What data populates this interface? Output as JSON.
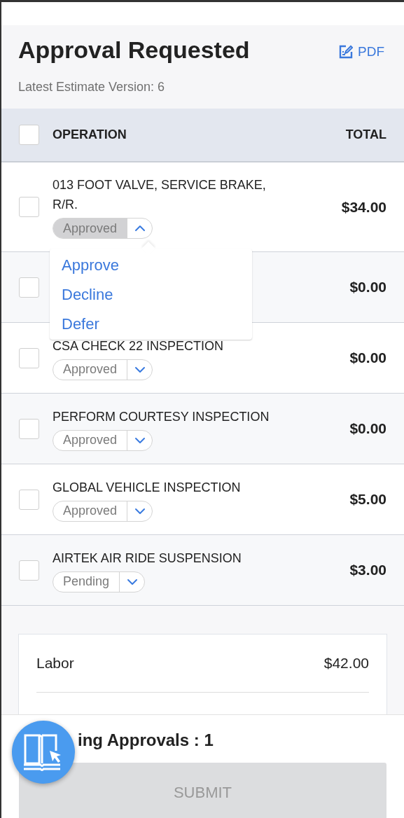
{
  "header": {
    "title": "Approval Requested",
    "pdf_label": "PDF",
    "subtitle": "Latest Estimate Version: 6"
  },
  "table": {
    "select_all_checked": false,
    "columns": [
      "OPERATION",
      "TOTAL"
    ],
    "rows": [
      {
        "operation": "013 FOOT VALVE, SERVICE BRAKE, R/R.",
        "total": "$34.00",
        "checked": false,
        "status": "Approved",
        "expanded": true,
        "menu": [
          "Approve",
          "Decline",
          "Defer"
        ]
      },
      {
        "total": "$0.00",
        "checked": false
      },
      {
        "operation": "CSA CHECK 22 INSPECTION",
        "total": "$0.00",
        "checked": false,
        "status": "Approved",
        "expanded": false
      },
      {
        "operation": "PERFORM COURTESY INSPECTION",
        "total": "$0.00",
        "checked": false,
        "status": "Approved",
        "expanded": false
      },
      {
        "operation": "GLOBAL VEHICLE INSPECTION",
        "total": "$5.00",
        "checked": false,
        "status": "Approved",
        "expanded": false
      },
      {
        "operation": "AIRTEK AIR RIDE SUSPENSION",
        "total": "$3.00",
        "checked": false,
        "status": "Pending",
        "expanded": false
      }
    ]
  },
  "summary": [
    {
      "label": "Labor",
      "value": "$42.00"
    }
  ],
  "footer": {
    "pending_text": "ing Approvals : 1",
    "submit_label": "SUBMIT",
    "submit_disabled": true
  }
}
